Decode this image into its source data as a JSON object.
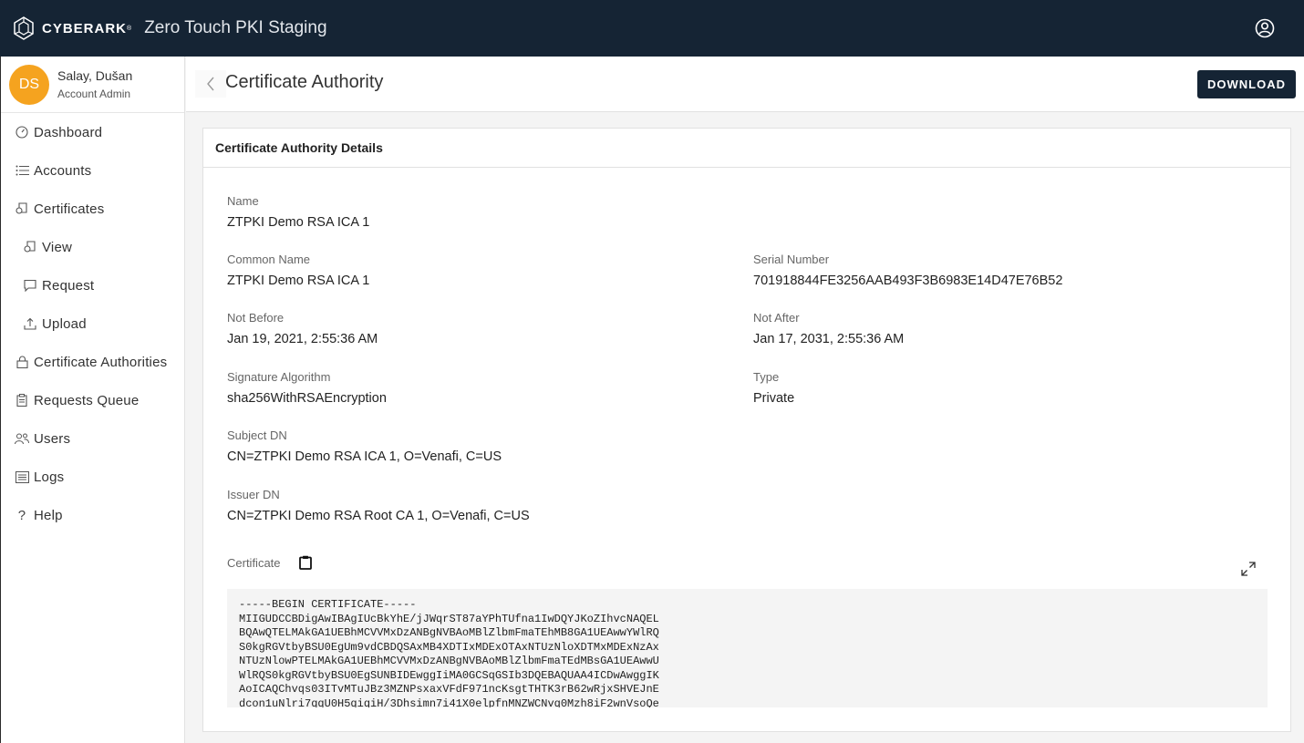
{
  "topbar": {
    "brand": "CYBERARK",
    "brand_mark": "®",
    "app_title": "Zero Touch PKI Staging"
  },
  "profile": {
    "initials": "DS",
    "name": "Salay, Dušan",
    "role": "Account Admin"
  },
  "nav": {
    "dashboard": "Dashboard",
    "accounts": "Accounts",
    "certificates": "Certificates",
    "view": "View",
    "request": "Request",
    "upload": "Upload",
    "certificate_authorities": "Certificate Authorities",
    "requests_queue": "Requests Queue",
    "users": "Users",
    "logs": "Logs",
    "help": "Help"
  },
  "header": {
    "title": "Certificate Authority",
    "download_label": "DOWNLOAD"
  },
  "details": {
    "title": "Certificate Authority Details",
    "name_label": "Name",
    "name": "ZTPKI Demo RSA ICA 1",
    "common_name_label": "Common Name",
    "common_name": "ZTPKI Demo RSA ICA 1",
    "serial_label": "Serial Number",
    "serial": "701918844FE3256AAB493F3B6983E14D47E76B52",
    "not_before_label": "Not Before",
    "not_before": "Jan 19, 2021, 2:55:36 AM",
    "not_after_label": "Not After",
    "not_after": "Jan 17, 2031, 2:55:36 AM",
    "sig_alg_label": "Signature Algorithm",
    "sig_alg": "sha256WithRSAEncryption",
    "type_label": "Type",
    "type": "Private",
    "subject_dn_label": "Subject DN",
    "subject_dn": "CN=ZTPKI Demo RSA ICA 1, O=Venafi, C=US",
    "issuer_dn_label": "Issuer DN",
    "issuer_dn": "CN=ZTPKI Demo RSA Root CA 1, O=Venafi, C=US",
    "certificate_label": "Certificate",
    "certificate_text": "-----BEGIN CERTIFICATE-----\nMIIGUDCCBDigAwIBAgIUcBkYhE/jJWqrST87aYPhTUfna1IwDQYJKoZIhvcNAQEL\nBQAwQTELMAkGA1UEBhMCVVMxDzANBgNVBAoMBlZlbmFmaTEhMB8GA1UEAwwYWlRQ\nS0kgRGVtbyBSU0EgUm9vdCBDQSAxMB4XDTIxMDExOTAxNTUzNloXDTMxMDExNzAx\nNTUzNlowPTELMAkGA1UEBhMCVVMxDzANBgNVBAoMBlZlbmFmaTEdMBsGA1UEAwwU\nWlRQS0kgRGVtbyBSU0EgSUNBIDEwggIiMA0GCSqGSIb3DQEBAQUAA4ICDwAwggIK\nAoICAQChvqs03ITvMTuJBz3MZNPsxaxVFdF971ncKsgtTHTK3rB62wRjxSHVEJnE\ndcon1uNlri7qqU0H5qiqiH/3Dhsimn7i41X0elpfnMNZWCNvq0Mzh8iF2wnVsoQe"
  },
  "colors": {
    "topbar_bg": "#152434",
    "avatar_bg": "#f5a31f",
    "primary_button": "#152434"
  },
  "icons": {
    "logo": "cyberark-logo-icon",
    "user": "user-circle-icon",
    "back": "chevron-left-icon",
    "copy": "clipboard-icon",
    "expand": "expand-icon"
  }
}
